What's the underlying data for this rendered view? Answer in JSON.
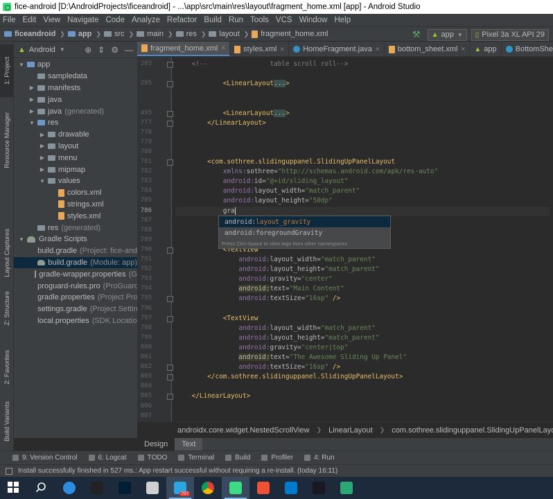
{
  "window": {
    "title": "fice-android [D:\\AndroidProjects\\ficeandroid] - ...\\app\\src\\main\\res\\layout\\fragment_home.xml [app] - Android Studio"
  },
  "menu": [
    "File",
    "Edit",
    "View",
    "Navigate",
    "Code",
    "Analyze",
    "Refactor",
    "Build",
    "Run",
    "Tools",
    "VCS",
    "Window",
    "Help"
  ],
  "breadcrumb": {
    "items": [
      "ficeandroid",
      "app",
      "src",
      "main",
      "res",
      "layout",
      "fragment_home.xml"
    ]
  },
  "run_config": {
    "module": "app",
    "device": "Pixel 3a XL API 29"
  },
  "left_strip": {
    "tabs": [
      "1: Project",
      "Resource Manager",
      "Layout Captures",
      "Z: Structure",
      "2: Favorites",
      "Build Variants"
    ]
  },
  "project_panel": {
    "view": "Android",
    "tree": [
      {
        "label": "app",
        "suffix": "",
        "depth": 0,
        "expanded": true,
        "icon": "folder-icon"
      },
      {
        "label": "sampledata",
        "suffix": "",
        "depth": 1,
        "expanded": null,
        "icon": "folder-icon"
      },
      {
        "label": "manifests",
        "suffix": "",
        "depth": 1,
        "expanded": false,
        "icon": "folder-icon"
      },
      {
        "label": "java",
        "suffix": "",
        "depth": 1,
        "expanded": false,
        "icon": "folder-icon"
      },
      {
        "label": "java",
        "suffix": "(generated)",
        "depth": 1,
        "expanded": false,
        "icon": "folder-icon"
      },
      {
        "label": "res",
        "suffix": "",
        "depth": 1,
        "expanded": true,
        "icon": "folder-icon"
      },
      {
        "label": "drawable",
        "suffix": "",
        "depth": 2,
        "expanded": false,
        "icon": "folder-icon"
      },
      {
        "label": "layout",
        "suffix": "",
        "depth": 2,
        "expanded": false,
        "icon": "folder-icon"
      },
      {
        "label": "menu",
        "suffix": "",
        "depth": 2,
        "expanded": false,
        "icon": "folder-icon"
      },
      {
        "label": "mipmap",
        "suffix": "",
        "depth": 2,
        "expanded": false,
        "icon": "folder-icon"
      },
      {
        "label": "values",
        "suffix": "",
        "depth": 2,
        "expanded": true,
        "icon": "folder-icon"
      },
      {
        "label": "colors.xml",
        "suffix": "",
        "depth": 3,
        "expanded": null,
        "icon": "xml-file-icon"
      },
      {
        "label": "strings.xml",
        "suffix": "",
        "depth": 3,
        "expanded": null,
        "icon": "xml-file-icon"
      },
      {
        "label": "styles.xml",
        "suffix": "",
        "depth": 3,
        "expanded": null,
        "icon": "xml-file-icon"
      },
      {
        "label": "res",
        "suffix": "(generated)",
        "depth": 1,
        "expanded": null,
        "icon": "folder-icon"
      },
      {
        "label": "Gradle Scripts",
        "suffix": "",
        "depth": 0,
        "expanded": true,
        "icon": "gradle-icon"
      },
      {
        "label": "build.gradle",
        "suffix": "(Project: fice-and",
        "depth": 1,
        "expanded": null,
        "icon": "gradle-file-icon"
      },
      {
        "label": "build.gradle",
        "suffix": "(Module: app)",
        "depth": 1,
        "expanded": null,
        "icon": "gradle-file-icon",
        "selected": true
      },
      {
        "label": "gradle-wrapper.properties",
        "suffix": "(G",
        "depth": 1,
        "expanded": null,
        "icon": "properties-file-icon"
      },
      {
        "label": "proguard-rules.pro",
        "suffix": "(ProGuard",
        "depth": 1,
        "expanded": null,
        "icon": "properties-file-icon"
      },
      {
        "label": "gradle.properties",
        "suffix": "(Project Pro",
        "depth": 1,
        "expanded": null,
        "icon": "properties-file-icon"
      },
      {
        "label": "settings.gradle",
        "suffix": "(Project Setting",
        "depth": 1,
        "expanded": null,
        "icon": "gradle-file-icon"
      },
      {
        "label": "local.properties",
        "suffix": "(SDK Location",
        "depth": 1,
        "expanded": null,
        "icon": "properties-file-icon"
      }
    ]
  },
  "editor_tabs": [
    {
      "label": "fragment_home.xml",
      "active": true,
      "icon": "xml-file-icon"
    },
    {
      "label": "styles.xml",
      "active": false,
      "icon": "xml-file-icon"
    },
    {
      "label": "HomeFragment.java",
      "active": false,
      "icon": "class-icon"
    },
    {
      "label": "bottom_sheet.xml",
      "active": false,
      "icon": "xml-file-icon"
    },
    {
      "label": "app",
      "active": false,
      "icon": "android-icon"
    },
    {
      "label": "BottomSheet",
      "active": false,
      "icon": "class-icon"
    }
  ],
  "editor": {
    "current_line": "786",
    "lines": [
      {
        "n": "203",
        "segs": [
          [
            "cm",
            "    <!--                table scroll roll-->"
          ]
        ]
      },
      {
        "n": "",
        "segs": []
      },
      {
        "n": "205",
        "segs": [
          [
            "t",
            "            "
          ],
          [
            "tg",
            "<LinearLayout"
          ],
          [
            "dots",
            "..."
          ],
          [
            "tg",
            ">"
          ]
        ]
      },
      {
        "n": "",
        "segs": []
      },
      {
        "n": "",
        "segs": []
      },
      {
        "n": "495",
        "segs": [
          [
            "t",
            "            "
          ],
          [
            "tg",
            "<LinearLayout"
          ],
          [
            "dots",
            "..."
          ],
          [
            "tg",
            ">"
          ]
        ]
      },
      {
        "n": "777",
        "segs": [
          [
            "t",
            "        "
          ],
          [
            "tg",
            "</LinearLayout>"
          ]
        ]
      },
      {
        "n": "778",
        "segs": []
      },
      {
        "n": "779",
        "segs": []
      },
      {
        "n": "780",
        "segs": []
      },
      {
        "n": "781",
        "segs": [
          [
            "t",
            "        "
          ],
          [
            "tg",
            "<com.sothree.slidinguppanel.SlidingUpPanelLayout"
          ]
        ]
      },
      {
        "n": "782",
        "segs": [
          [
            "t",
            "            "
          ],
          [
            "ns",
            "xmlns:"
          ],
          [
            "at",
            "sothree="
          ],
          [
            "st",
            "\"http://schemas.android.com/apk/res-auto\""
          ]
        ]
      },
      {
        "n": "783",
        "segs": [
          [
            "t",
            "            "
          ],
          [
            "ns",
            "android:"
          ],
          [
            "at",
            "id="
          ],
          [
            "st",
            "\"@+id/sliding_layout\""
          ]
        ]
      },
      {
        "n": "784",
        "segs": [
          [
            "t",
            "            "
          ],
          [
            "ns",
            "android:"
          ],
          [
            "at",
            "layout_width="
          ],
          [
            "st",
            "\"match_parent\""
          ]
        ]
      },
      {
        "n": "785",
        "segs": [
          [
            "t",
            "            "
          ],
          [
            "ns",
            "android:"
          ],
          [
            "at",
            "layout_height="
          ],
          [
            "st",
            "\"50dp\""
          ]
        ]
      },
      {
        "n": "786",
        "segs": [
          [
            "t",
            "            "
          ],
          [
            "at",
            "gra"
          ]
        ],
        "cursor": true
      },
      {
        "n": "787",
        "segs": []
      },
      {
        "n": "788",
        "segs": []
      },
      {
        "n": "789",
        "segs": []
      },
      {
        "n": "790",
        "segs": [
          [
            "t",
            "            "
          ],
          [
            "tg",
            "<TextView"
          ]
        ]
      },
      {
        "n": "791",
        "segs": [
          [
            "t",
            "                "
          ],
          [
            "ns",
            "android:"
          ],
          [
            "at",
            "layout_width="
          ],
          [
            "st",
            "\"match_parent\""
          ]
        ]
      },
      {
        "n": "792",
        "segs": [
          [
            "t",
            "                "
          ],
          [
            "ns",
            "android:"
          ],
          [
            "at",
            "layout_height="
          ],
          [
            "st",
            "\"match_parent\""
          ]
        ]
      },
      {
        "n": "793",
        "segs": [
          [
            "t",
            "                "
          ],
          [
            "ns",
            "android:"
          ],
          [
            "at",
            "gravity="
          ],
          [
            "st",
            "\"center\""
          ]
        ]
      },
      {
        "n": "794",
        "segs": [
          [
            "t",
            "                "
          ],
          [
            "hl",
            "android:"
          ],
          [
            "at",
            "text="
          ],
          [
            "st",
            "\"Main Content\""
          ]
        ]
      },
      {
        "n": "795",
        "segs": [
          [
            "t",
            "                "
          ],
          [
            "ns",
            "android:"
          ],
          [
            "at",
            "textSize="
          ],
          [
            "st",
            "\"16sp\""
          ],
          [
            "tg",
            " />"
          ]
        ]
      },
      {
        "n": "796",
        "segs": []
      },
      {
        "n": "797",
        "segs": [
          [
            "t",
            "            "
          ],
          [
            "tg",
            "<TextView"
          ]
        ]
      },
      {
        "n": "798",
        "segs": [
          [
            "t",
            "                "
          ],
          [
            "ns",
            "android:"
          ],
          [
            "at",
            "layout_width="
          ],
          [
            "st",
            "\"match_parent\""
          ]
        ]
      },
      {
        "n": "799",
        "segs": [
          [
            "t",
            "                "
          ],
          [
            "ns",
            "android:"
          ],
          [
            "at",
            "layout_height="
          ],
          [
            "st",
            "\"match_parent\""
          ]
        ]
      },
      {
        "n": "800",
        "segs": [
          [
            "t",
            "                "
          ],
          [
            "ns",
            "android:"
          ],
          [
            "at",
            "gravity="
          ],
          [
            "st",
            "\"center|top\""
          ]
        ]
      },
      {
        "n": "801",
        "segs": [
          [
            "t",
            "                "
          ],
          [
            "hl",
            "android:"
          ],
          [
            "at",
            "text="
          ],
          [
            "st",
            "\"The Awesome Sliding Up Panel\""
          ]
        ]
      },
      {
        "n": "802",
        "segs": [
          [
            "t",
            "                "
          ],
          [
            "ns",
            "android:"
          ],
          [
            "at",
            "textSize="
          ],
          [
            "st",
            "\"16sp\""
          ],
          [
            "tg",
            " />"
          ]
        ]
      },
      {
        "n": "803",
        "segs": [
          [
            "t",
            "        "
          ],
          [
            "tg",
            "</com.sothree.slidinguppanel.SlidingUpPanelLayout>"
          ]
        ]
      },
      {
        "n": "804",
        "segs": []
      },
      {
        "n": "805",
        "segs": [
          [
            "t",
            "    "
          ],
          [
            "tg",
            "</LinearLayout>"
          ]
        ]
      },
      {
        "n": "806",
        "segs": []
      },
      {
        "n": "807",
        "segs": []
      }
    ]
  },
  "autocomplete": {
    "items": [
      {
        "prefix": "android:",
        "match": "layout_gravity",
        "selected": true
      },
      {
        "prefix": "android:",
        "match": "foregroundGravity",
        "selected": false
      }
    ],
    "hint": "Press Ctrl+Space to view tags from other namespaces"
  },
  "xml_breadcrumb": [
    "androidx.core.widget.NestedScrollView",
    "LinearLayout",
    "com.sothree.slidinguppanel.SlidingUpPanelLayout"
  ],
  "design_tabs": [
    "Design",
    "Text"
  ],
  "tool_windows": [
    {
      "label": "9: Version Control",
      "icon": "vcs-icon"
    },
    {
      "label": "6: Logcat",
      "icon": "logcat-icon"
    },
    {
      "label": "TODO",
      "icon": "todo-icon"
    },
    {
      "label": "Terminal",
      "icon": "terminal-icon"
    },
    {
      "label": "Build",
      "icon": "build-icon"
    },
    {
      "label": "Profiler",
      "icon": "profiler-icon"
    },
    {
      "label": "4: Run",
      "icon": "run-icon"
    }
  ],
  "status": "Install successfully finished in 527 ms.: App restart successful without requiring a re-install. (today 16:11)",
  "taskbar": {
    "apps": [
      "windows-start",
      "search",
      "edge",
      "inkscape",
      "photoshop",
      "paint",
      "telegram",
      "chrome",
      "android-studio",
      "git-tool",
      "vscode",
      "steam",
      "todo-app"
    ],
    "telegram_badge": "707"
  }
}
